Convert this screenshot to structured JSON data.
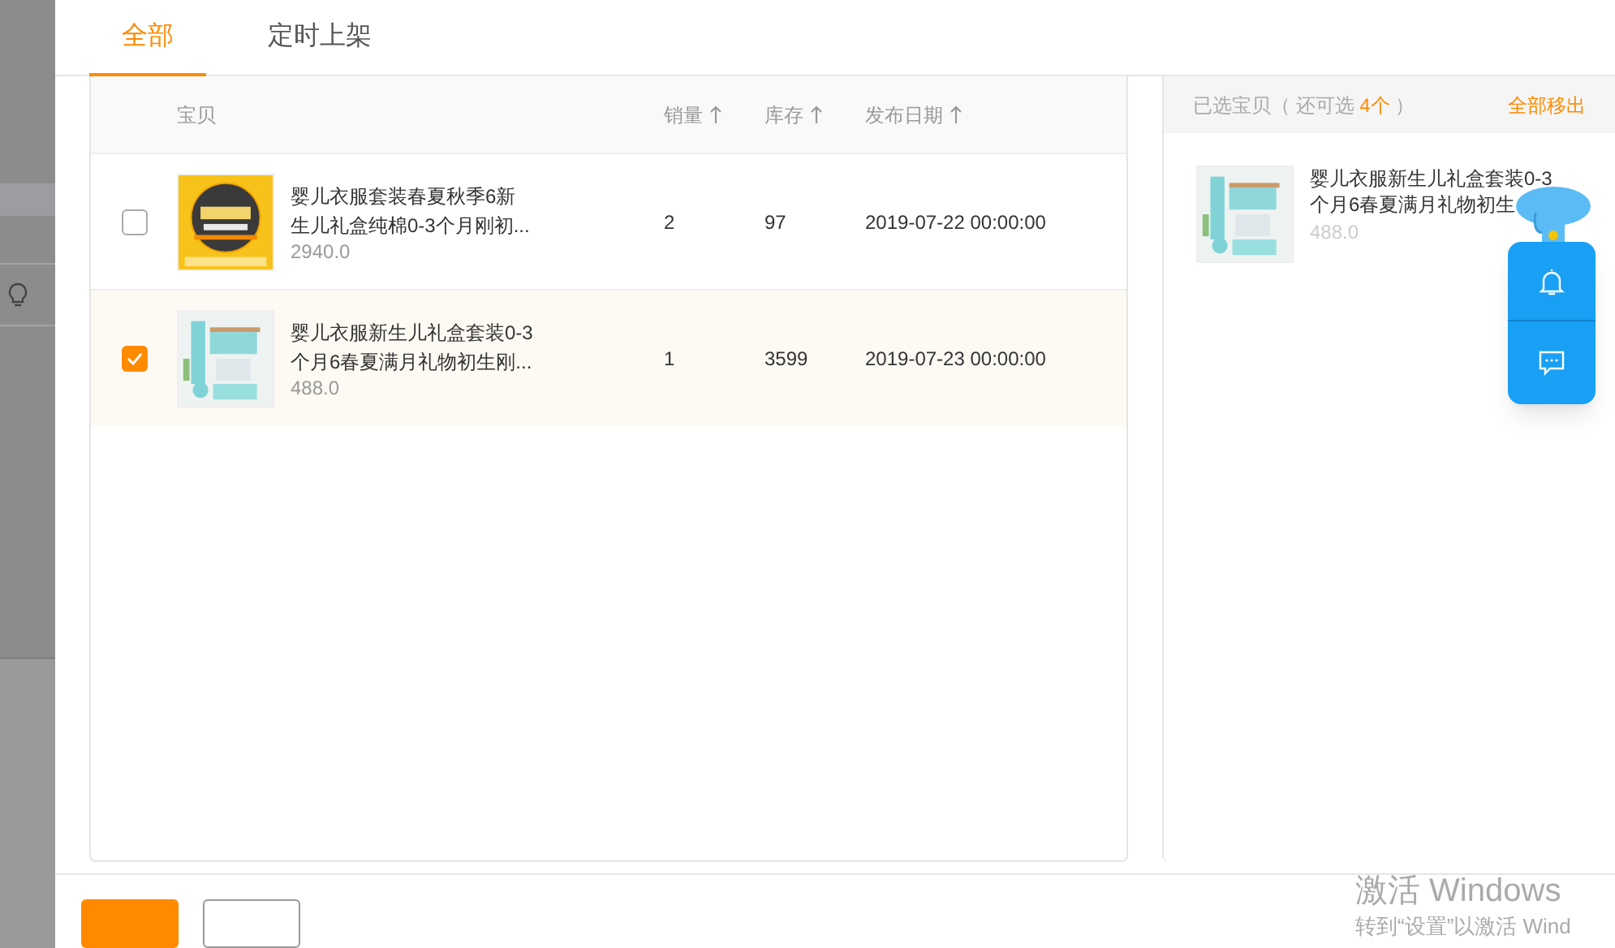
{
  "tabs": [
    {
      "label": "全部",
      "selected": true
    },
    {
      "label": "定时上架",
      "selected": false
    }
  ],
  "table": {
    "columns": [
      {
        "label": "宝贝",
        "sortable": false
      },
      {
        "label": "销量",
        "sortable": true
      },
      {
        "label": "库存",
        "sortable": true
      },
      {
        "label": "发布日期",
        "sortable": true
      }
    ],
    "rows": [
      {
        "checked": false,
        "title": [
          "婴儿衣服套装春夏秋季6新",
          "生儿礼盒纯棉0-3个月刚初..."
        ],
        "price": "2940.0",
        "sales": "2",
        "stock": "97",
        "date": "2019-07-22 00:00:00"
      },
      {
        "checked": true,
        "title": [
          "婴儿衣服新生儿礼盒套装0-3",
          "个月6春夏满月礼物初生刚..."
        ],
        "price": "488.0",
        "sales": "1",
        "stock": "3599",
        "date": "2019-07-23 00:00:00"
      }
    ]
  },
  "selected_panel": {
    "prefix": "已选宝贝（ 还可选 ",
    "count": "4个",
    "suffix": " ）",
    "remove_all": "全部移出",
    "items": [
      {
        "title": [
          "婴儿衣服新生儿礼盒套装0-3",
          "个月6春夏满月礼物初生"
        ],
        "price": "488.0"
      }
    ]
  },
  "os_notice": {
    "title": "激活 Windows",
    "subtitle": "转到“设置”以激活 Wind"
  }
}
